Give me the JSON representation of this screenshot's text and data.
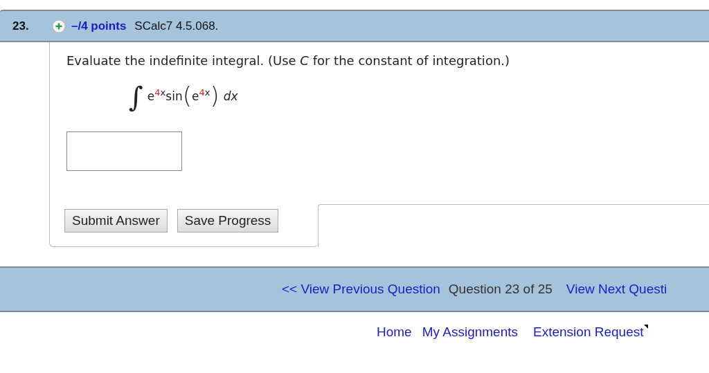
{
  "question": {
    "number": "23.",
    "points": "–/4 points",
    "source": "SCalc7 4.5.068."
  },
  "prompt": "Evaluate the indefinite integral. (Use *C* for the constant of integration.)",
  "integral": {
    "sign": "∫",
    "outer": {
      "base": "e",
      "coefficient": "4",
      "variable": "x"
    },
    "function": "sin",
    "open_paren": "(",
    "inner": {
      "base": "e",
      "coefficient": "4",
      "variable": "x"
    },
    "close_paren": ")",
    "differential": "dx"
  },
  "buttons": [
    "Submit Answer",
    "Save Progress"
  ],
  "navigation": {
    "previous": "<< View Previous Question",
    "position": "Question 23 of 25",
    "next": "View Next Questi"
  },
  "footer_links": [
    {
      "label": "Home",
      "external": false
    },
    {
      "label": "My Assignments",
      "external": false
    },
    {
      "label": "Extension Request",
      "external": true
    }
  ]
}
